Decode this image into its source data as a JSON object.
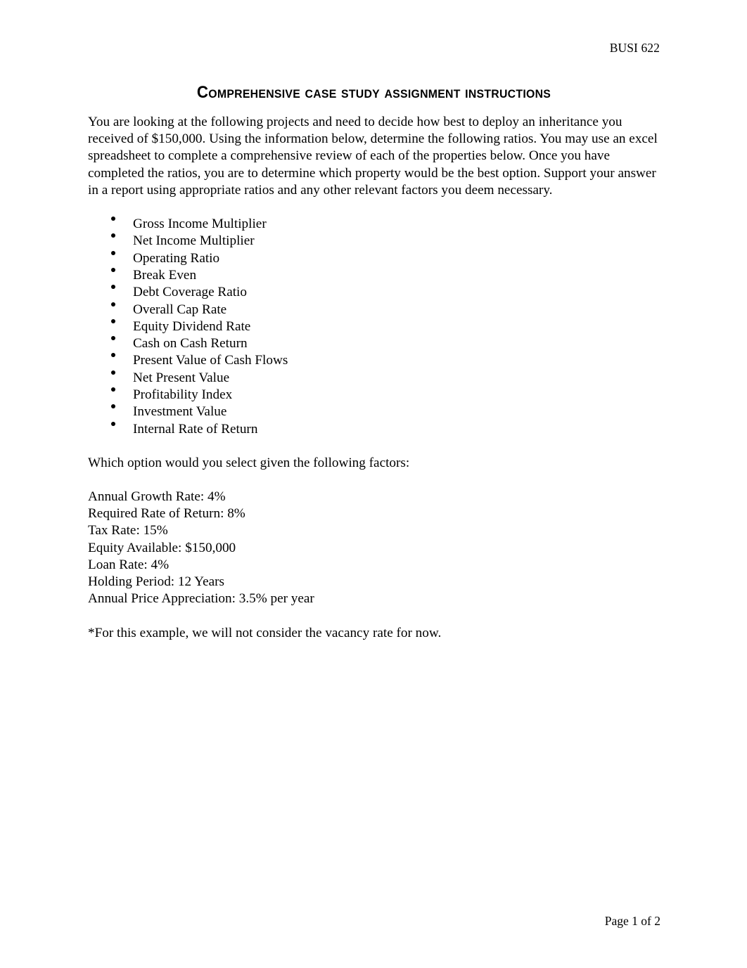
{
  "header": {
    "course_code": "BUSI 622"
  },
  "document": {
    "title": "Comprehensive Case Study Assignment Instructions",
    "intro_paragraph": "You are looking at the following projects and need to decide how best to deploy an inheritance you received of $150,000. Using the information below, determine the following ratios. You may use an excel spreadsheet to complete a comprehensive review of each of the properties below. Once you have completed the ratios, you are to determine which property would be the best option. Support your answer in a report using appropriate ratios and any other relevant factors you deem necessary.",
    "ratios": [
      "Gross Income Multiplier",
      "Net Income Multiplier",
      "Operating Ratio",
      "Break Even",
      "Debt Coverage Ratio",
      "Overall Cap Rate",
      "Equity Dividend Rate",
      "Cash on Cash Return",
      "Present Value of Cash Flows",
      "Net Present Value",
      "Profitability Index",
      "Investment Value",
      "Internal Rate of Return"
    ],
    "question_prompt": "Which option would you select given the following factors:",
    "factors": [
      "Annual Growth Rate: 4%",
      "Required Rate of Return: 8%",
      "Tax Rate: 15%",
      "Equity Available: $150,000",
      "Loan Rate: 4%",
      "Holding Period: 12 Years",
      "Annual Price Appreciation: 3.5% per year"
    ],
    "footnote": "*For this example, we will not consider the vacancy rate for now."
  },
  "footer": {
    "page_label": "Page 1 of 2"
  },
  "style": {
    "text_color": "#000000",
    "page_background": "#ffffff"
  }
}
